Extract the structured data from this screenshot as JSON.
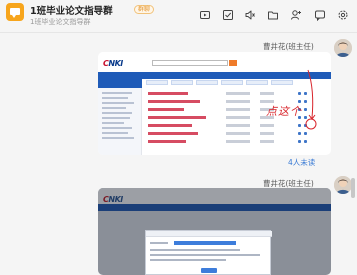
{
  "header": {
    "title": "1班毕业论文指导群",
    "tag": "群聊",
    "subtitle": "1班毕业论文指导群",
    "icons": [
      "video-icon",
      "task-check-icon",
      "mute-icon",
      "folder-icon",
      "add-member-icon",
      "message-icon",
      "settings-icon"
    ]
  },
  "messages": [
    {
      "sender": "曹井花(班主任)",
      "type": "image",
      "annotation": "点这个",
      "unread": "4人未读"
    },
    {
      "sender": "曹井花(班主任)",
      "type": "image"
    }
  ],
  "colors": {
    "brand_orange": "#f7a51c",
    "annotation_red": "#d8232a",
    "unread_blue": "#3a7bd5",
    "cnki_blue": "#1f5bb8"
  }
}
